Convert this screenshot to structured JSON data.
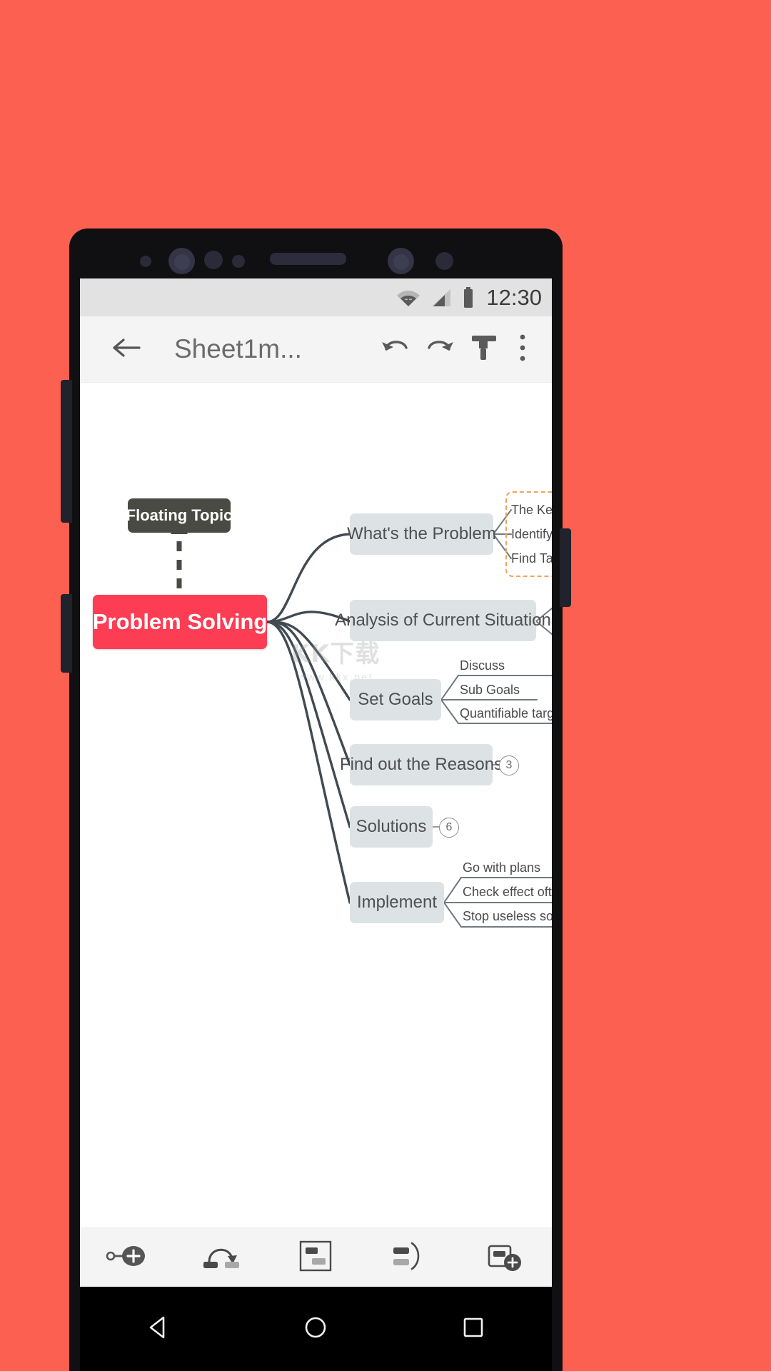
{
  "background_color": "#fc6050",
  "status_bar": {
    "time": "12:30",
    "icons": [
      "wifi-icon",
      "signal-icon",
      "battery-icon"
    ]
  },
  "toolbar": {
    "back_icon": "back-arrow-icon",
    "title": "Sheet1m...",
    "undo_icon": "undo-icon",
    "redo_icon": "redo-icon",
    "theme_icon": "theme-brush-icon",
    "overflow_icon": "more-vertical-icon"
  },
  "mindmap": {
    "central": {
      "label": "Problem Solving",
      "color": "#fc3d53"
    },
    "floating": {
      "label": "Floating Topic",
      "color": "#4a4a45"
    },
    "branches": [
      {
        "label": "What's the Problem",
        "children": [
          "The Key Point",
          "Identify the Problem",
          "Find Target Point"
        ]
      },
      {
        "label": "Analysis of Current Situation",
        "children": []
      },
      {
        "label": "Set Goals",
        "children": [
          "Discuss",
          "Sub Goals",
          "Quantifiable targets"
        ]
      },
      {
        "label": "Find out the Reasons",
        "badge": "3",
        "children": []
      },
      {
        "label": "Solutions",
        "badge": "6",
        "children": []
      },
      {
        "label": "Implement",
        "children": [
          "Go with plans",
          "Check effect often",
          "Stop useless solutions"
        ]
      }
    ],
    "node_color": "#dde3e4",
    "line_color": "#414a52",
    "highlight_outline_color": "#f0a35e"
  },
  "watermark": {
    "text_cn": "KK下载",
    "url": "www.kkx.net"
  },
  "bottom_bar": {
    "items": [
      {
        "name": "add-subtopic-icon"
      },
      {
        "name": "add-relationship-icon"
      },
      {
        "name": "insert-boundary-icon"
      },
      {
        "name": "add-summary-icon"
      },
      {
        "name": "add-floating-topic-icon"
      }
    ]
  },
  "nav_bar": {
    "back": "nav-back-triangle-icon",
    "home": "nav-home-circle-icon",
    "recents": "nav-recents-square-icon"
  }
}
